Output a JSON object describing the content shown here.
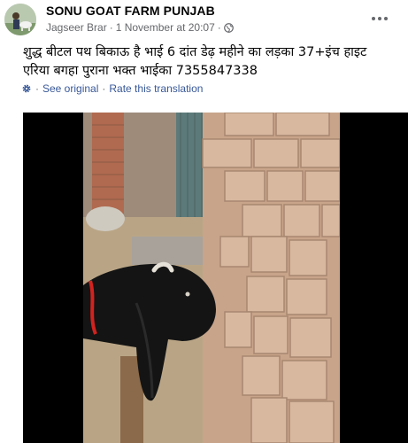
{
  "post": {
    "group_name": "SONU GOAT FARM PUNJAB",
    "author": "Jagseer Brar",
    "separator": "·",
    "timestamp": "1 November at 20:07",
    "visibility_icon": "globe-icon",
    "more_icon": "more-horizontal-icon",
    "text": "शुद्ध बीटल पथ बिकाऊ है भाई 6 दांत डेढ़ महीने का लड़का 37+इंच हाइट एरिया बगहा पुराना भक्त भाईका 7355847338",
    "translation": {
      "icon": "translate-gear-icon",
      "see_original": "See original",
      "divider": "·",
      "rate": "Rate this translation"
    },
    "media": {
      "type": "photo",
      "subject": "goat"
    }
  },
  "colors": {
    "link": "#385898",
    "meta": "#65676b",
    "text": "#050505",
    "media_background": "#000000"
  }
}
